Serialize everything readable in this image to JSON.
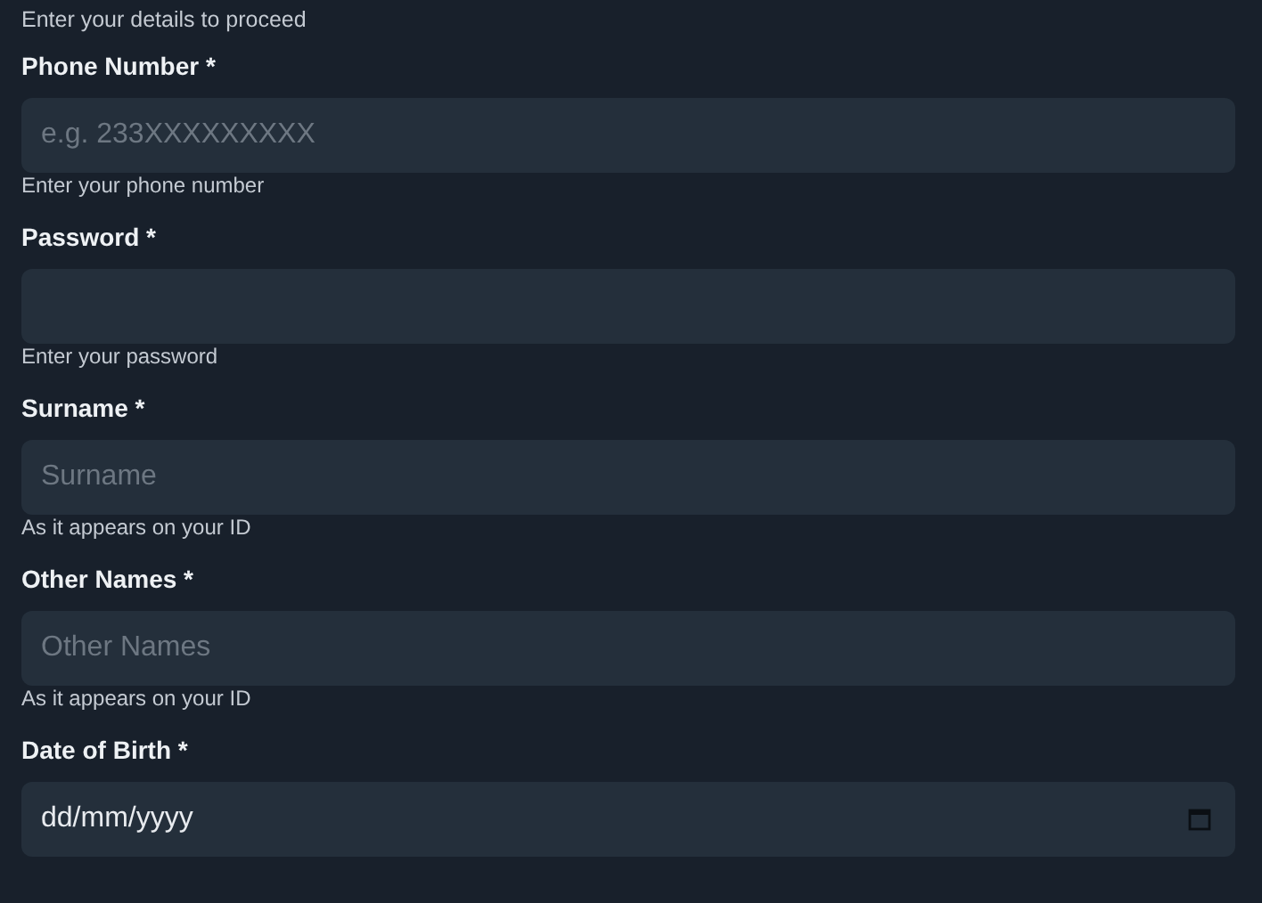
{
  "subtitle": "Enter your details to proceed",
  "fields": [
    {
      "kind": "text",
      "label": "Phone Number *",
      "placeholder": "e.g. 233XXXXXXXXX",
      "hint": "Enter your phone number"
    },
    {
      "kind": "password",
      "label": "Password *",
      "hint": "Enter your password"
    },
    {
      "kind": "text",
      "label": "Surname *",
      "placeholder": "Surname",
      "hint": "As it appears on your ID"
    },
    {
      "kind": "text",
      "label": "Other Names *",
      "placeholder": "Other Names",
      "hint": "As it appears on your ID"
    },
    {
      "kind": "date",
      "label": "Date of Birth *",
      "value": "dd/mm/yyyy"
    }
  ]
}
